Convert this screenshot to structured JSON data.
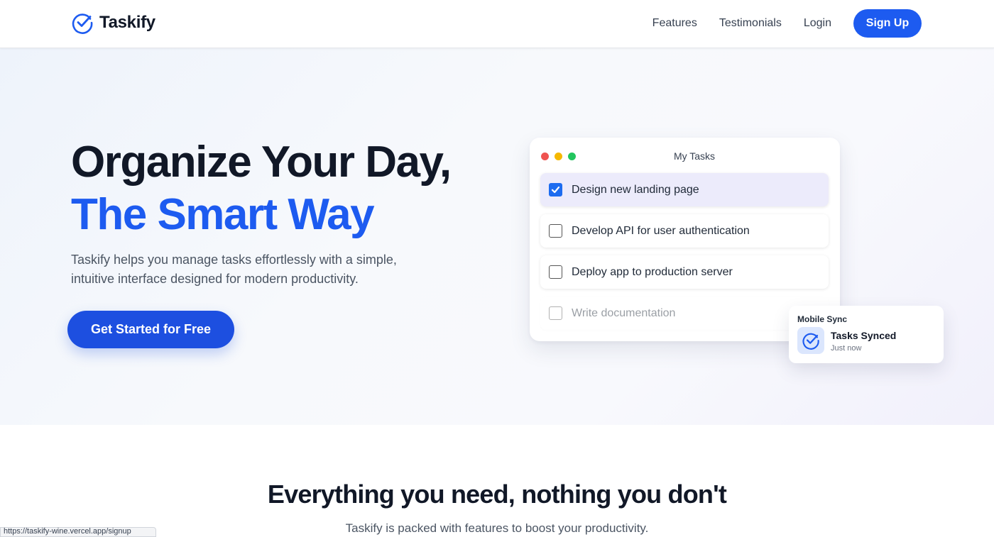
{
  "header": {
    "logo_text": "Taskify",
    "nav": [
      {
        "label": "Features"
      },
      {
        "label": "Testimonials"
      },
      {
        "label": "Login"
      }
    ],
    "signup_label": "Sign Up"
  },
  "hero": {
    "title_line1": "Organize Your Day,",
    "title_line2": "The Smart Way",
    "description": "Taskify helps you manage tasks effortlessly with a simple, intuitive interface designed for modern productivity.",
    "cta_label": "Get Started for Free"
  },
  "task_card": {
    "title": "My Tasks",
    "window_dots": [
      "#ef5350",
      "#f5b800",
      "#22c55e"
    ],
    "tasks": [
      {
        "label": "Design new landing page",
        "checked": true
      },
      {
        "label": "Develop API for user authentication",
        "checked": false
      },
      {
        "label": "Deploy app to production server",
        "checked": false
      },
      {
        "label": "Write documentation",
        "checked": false
      }
    ]
  },
  "sync_notification": {
    "heading": "Mobile Sync",
    "title": "Tasks Synced",
    "time": "Just now",
    "icon": "check-circle-icon"
  },
  "features": {
    "title": "Everything you need, nothing you don't",
    "subtitle": "Taskify is packed with features to boost your productivity."
  },
  "status_bar": {
    "url": "https://taskify-wine.vercel.app/signup"
  },
  "colors": {
    "brand_blue": "#1d5bf0",
    "checkbox_blue": "#1d6cf0",
    "active_task_bg": "#ecebfb"
  }
}
